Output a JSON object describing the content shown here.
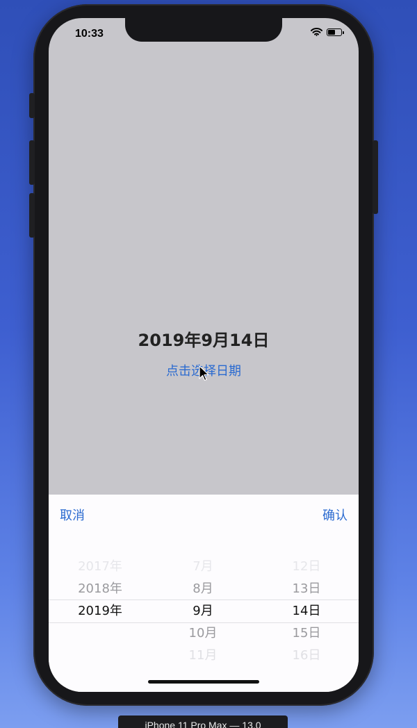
{
  "status_bar": {
    "time": "10:33"
  },
  "main": {
    "selected_date": "2019年9月14日",
    "pick_link": "点击选择日期"
  },
  "picker": {
    "cancel_label": "取消",
    "confirm_label": "确认",
    "years": [
      "2017年",
      "2018年",
      "2019年",
      "",
      ""
    ],
    "months": [
      "7月",
      "8月",
      "9月",
      "10月",
      "11月"
    ],
    "days": [
      "12日",
      "13日",
      "14日",
      "15日",
      "16日"
    ],
    "selected": {
      "year": "2019年",
      "month": "9月",
      "day": "14日"
    }
  },
  "simulator": {
    "device_label": "iPhone 11 Pro Max — 13.0"
  },
  "colors": {
    "accent": "#2a6ad0",
    "screen_bg": "#c7c6cb",
    "sheet_bg": "#fdfcfe"
  }
}
